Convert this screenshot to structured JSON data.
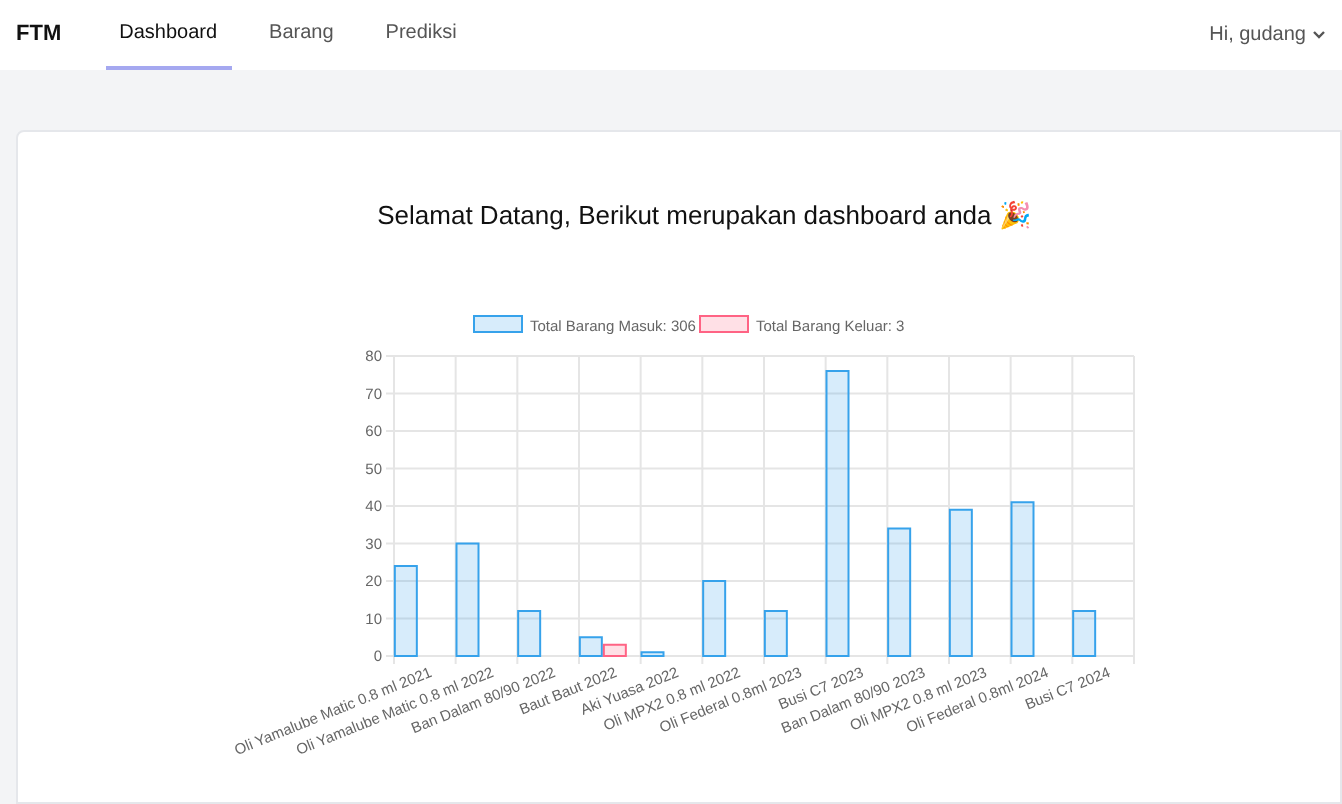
{
  "nav": {
    "brand": "FTM",
    "tabs": [
      {
        "label": "Dashboard",
        "selected": true
      },
      {
        "label": "Barang",
        "selected": false
      },
      {
        "label": "Prediksi",
        "selected": false
      }
    ],
    "user": "Hi, gudang"
  },
  "heading": "Selamat Datang, Berikut merupakan dashboard anda 🎉",
  "chart_data": {
    "type": "bar",
    "categories": [
      "Oli Yamalube Matic 0.8 ml 2021",
      "Oli Yamalube Matic 0.8 ml 2022",
      "Ban Dalam 80/90 2022",
      "Baut Baut 2022",
      "Aki Yuasa 2022",
      "Oli MPX2 0.8 ml 2022",
      "Oli Federal 0.8ml 2023",
      "Busi C7 2023",
      "Ban Dalam 80/90 2023",
      "Oli MPX2 0.8 ml 2023",
      "Oli Federal 0.8ml 2024",
      "Busi C7 2024"
    ],
    "series": [
      {
        "name": "Total Barang Masuk: 306",
        "color": "#36a2eb",
        "values": [
          24,
          30,
          12,
          5,
          1,
          20,
          12,
          76,
          34,
          39,
          41,
          12
        ]
      },
      {
        "name": "Total Barang Keluar: 3",
        "color": "#ff6384",
        "values": [
          0,
          0,
          0,
          3,
          0,
          0,
          0,
          0,
          0,
          0,
          0,
          0
        ]
      }
    ],
    "grid": true,
    "legend": true,
    "ylim": [
      0,
      80
    ],
    "yticks": [
      0,
      10,
      20,
      30,
      40,
      50,
      60,
      70,
      80
    ]
  }
}
